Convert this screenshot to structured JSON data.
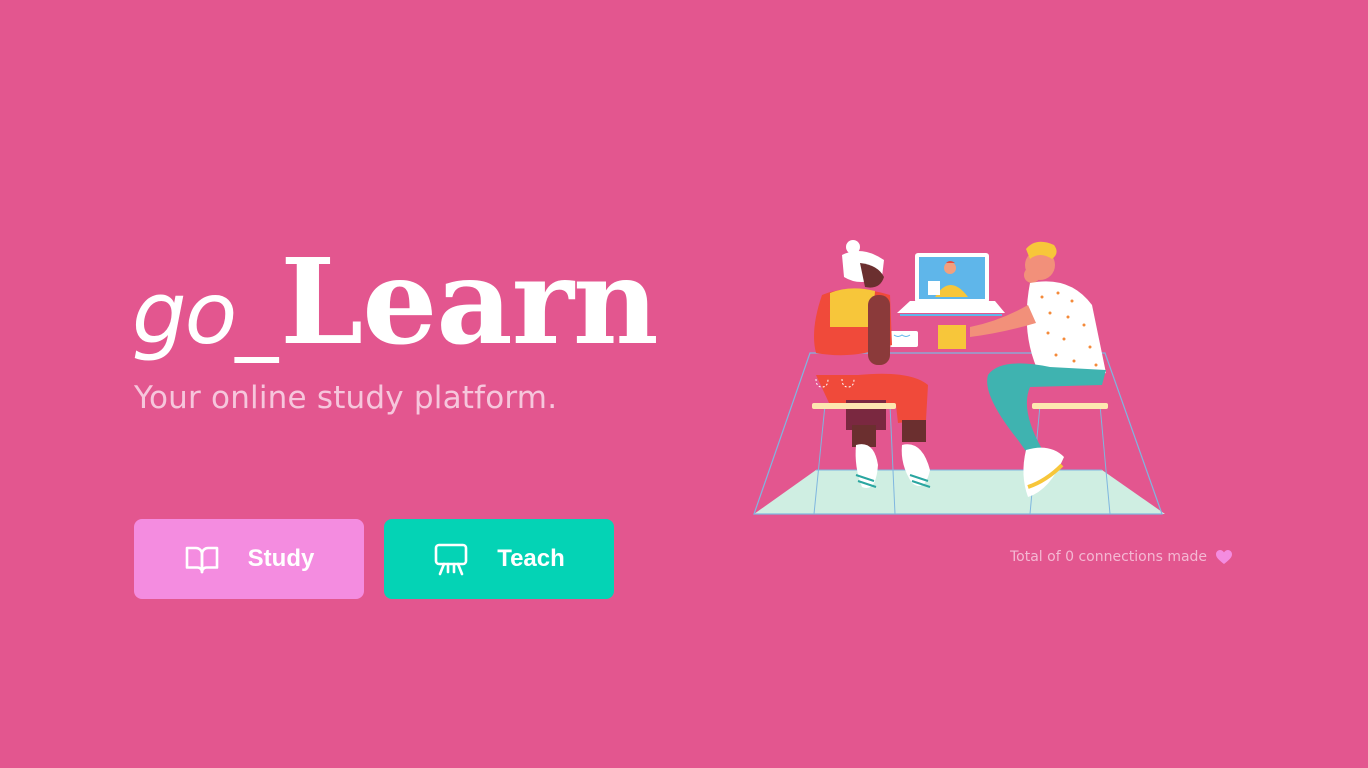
{
  "logo": {
    "prefix": "go_",
    "main": "Learn"
  },
  "tagline": "Your online study platform.",
  "buttons": {
    "study": {
      "label": "Study",
      "icon": "book-icon"
    },
    "teach": {
      "label": "Teach",
      "icon": "presentation-icon"
    }
  },
  "connections": {
    "text": "Total of 0 connections made",
    "icon": "heart-icon"
  },
  "colors": {
    "background": "#e3568f",
    "study_button": "#f48ce0",
    "teach_button": "#04d3b5",
    "text": "#ffffff"
  }
}
